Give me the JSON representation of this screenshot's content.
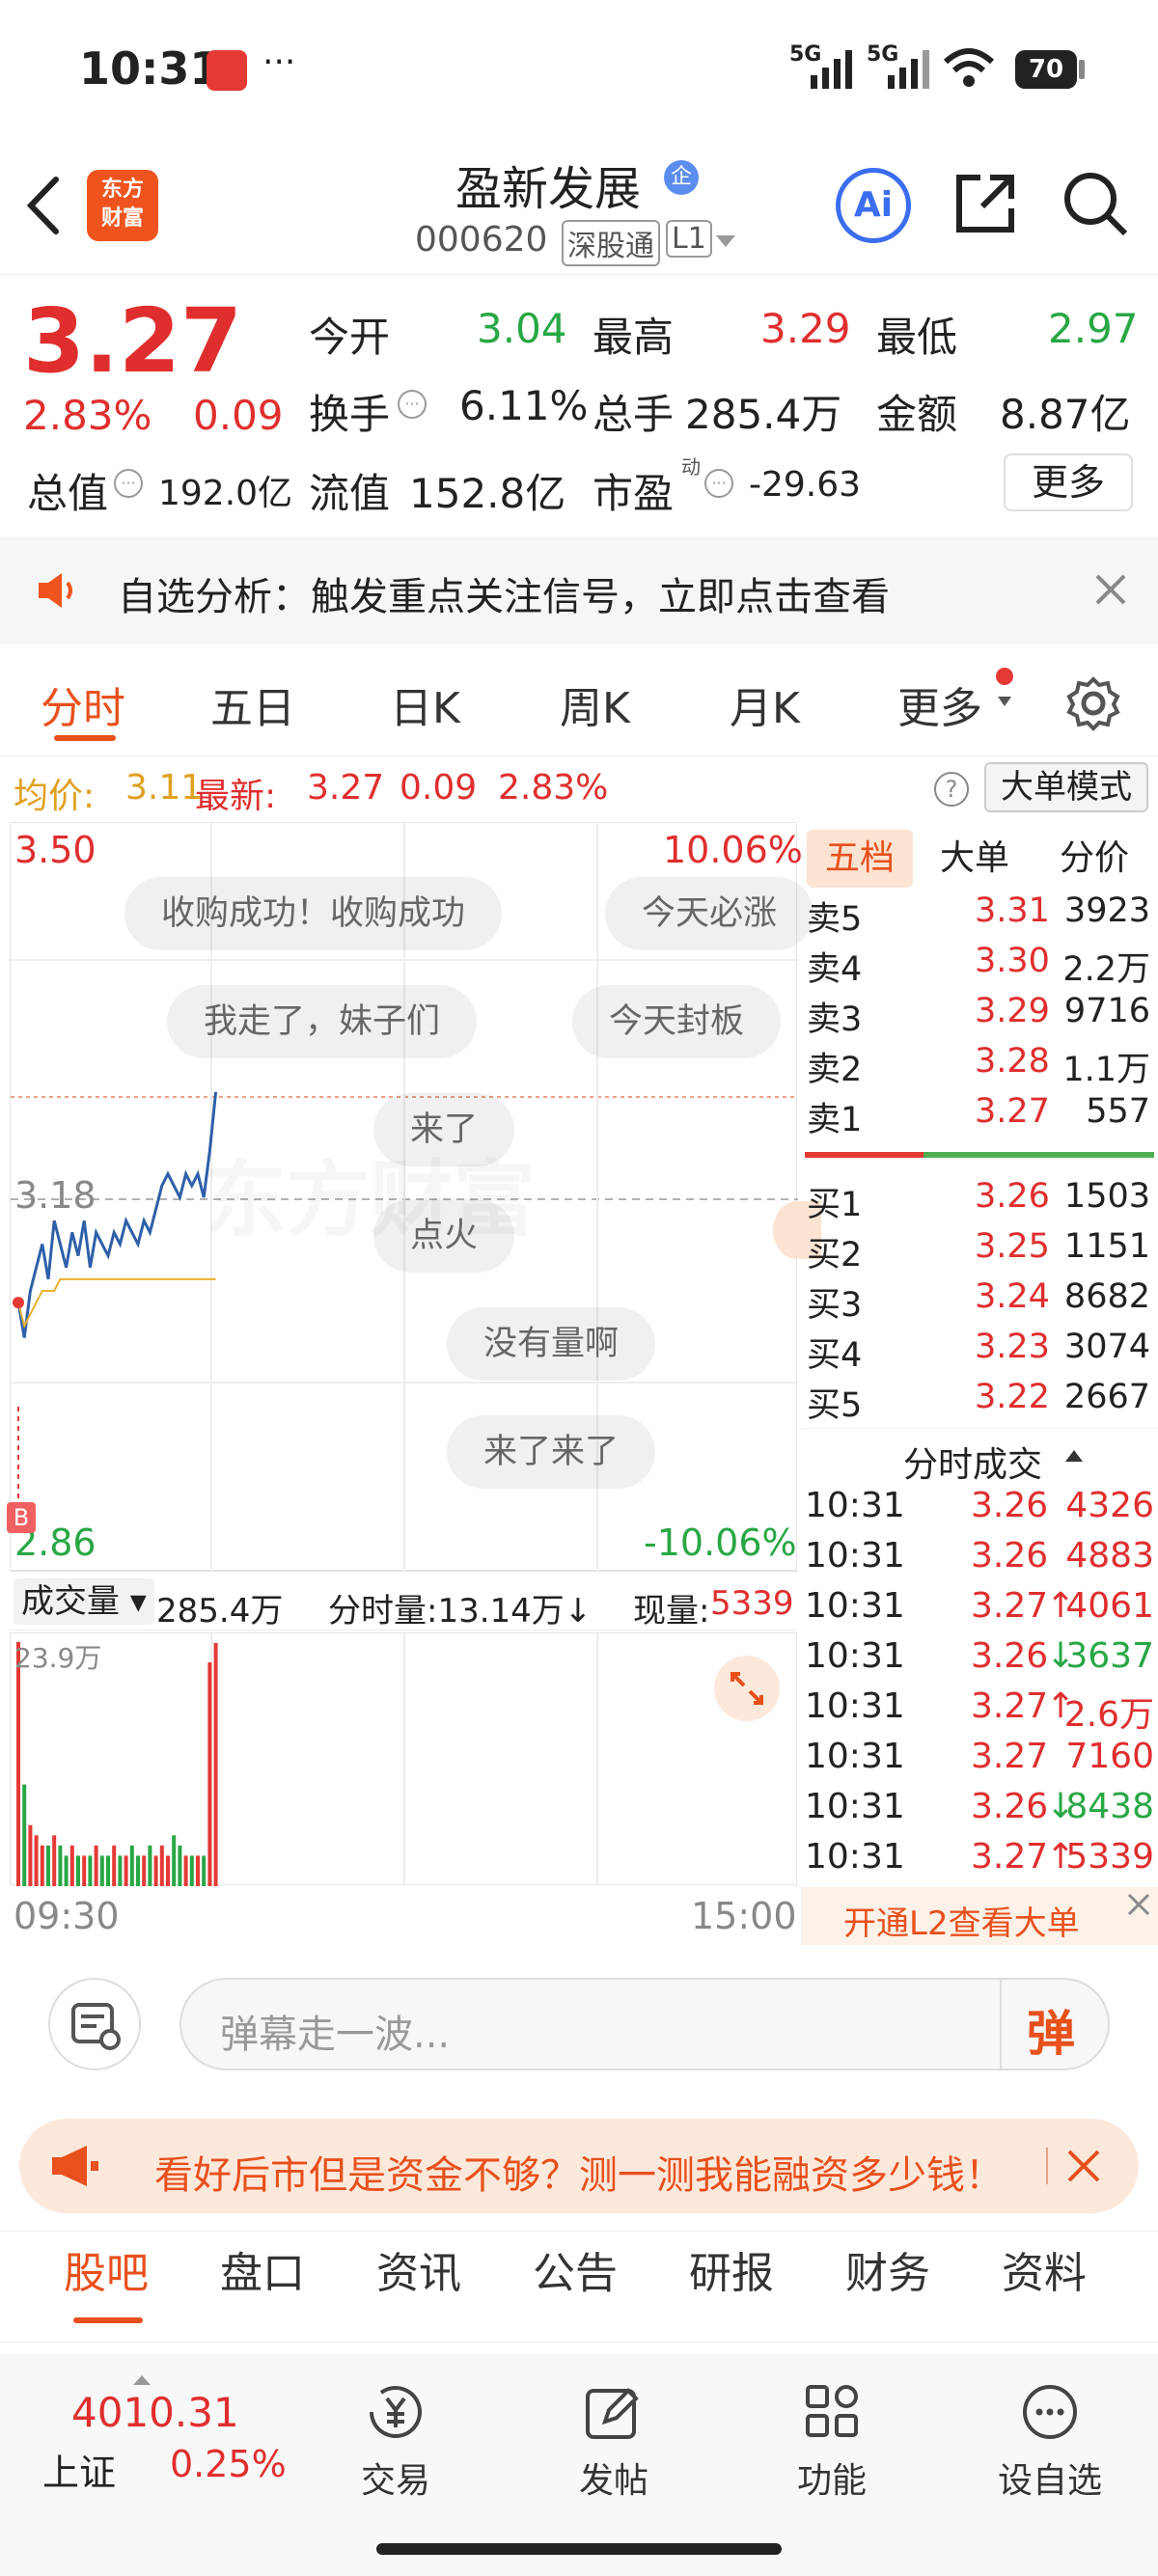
{
  "status_bar": {
    "time": "10:31",
    "dots": "···",
    "signal1": "5G",
    "signal2": "5G",
    "battery": "70"
  },
  "header": {
    "logo_line1": "东方",
    "logo_line2": "财富",
    "stock_name": "盈新发展",
    "badge": "企",
    "code": "000620",
    "exchange_tag": "深股通",
    "level_tag": "L1"
  },
  "quote": {
    "price": "3.27",
    "change_pct": "2.83%",
    "change": "0.09",
    "open_label": "今开",
    "open": "3.04",
    "high_label": "最高",
    "high": "3.29",
    "low_label": "最低",
    "low": "2.97",
    "turnover_label": "换手",
    "turnover": "6.11%",
    "volume_label": "总手",
    "volume": "285.4万",
    "amount_label": "金额",
    "amount": "8.87亿",
    "mktcap_label": "总值",
    "mktcap": "192.0亿",
    "float_label": "流值",
    "float": "152.8亿",
    "pe_label": "市盈",
    "pe_sup": "动",
    "pe": "-29.63",
    "more": "更多"
  },
  "notice": {
    "text": "自选分析：触发重点关注信号，立即点击查看"
  },
  "chart_tabs": [
    "分时",
    "五日",
    "日K",
    "周K",
    "月K",
    "更多"
  ],
  "info_line": {
    "avg_label": "均价:",
    "avg": "3.11",
    "latest_label": "最新:",
    "latest": "3.27",
    "chg": "0.09",
    "pct": "2.83%",
    "mode": "大单模式"
  },
  "chart_labels": {
    "top_price": "3.50",
    "top_pct": "10.06%",
    "mid_price": "3.18",
    "bot_price": "2.86",
    "bot_pct": "-10.06%",
    "b_marker": "B"
  },
  "danmaku": [
    "收购成功！收购成功",
    "今天必涨",
    "我走了，妹子们",
    "今天封板",
    "来了",
    "点火",
    "没有量啊",
    "来了来了"
  ],
  "volume_bar": {
    "label": "成交量",
    "total": "285.4万",
    "tick_label": "分时量:13.14万↓",
    "now_label": "现量:",
    "now": "5339",
    "max": "23.9万",
    "start_time": "09:30",
    "end_time": "15:00"
  },
  "chart_data": {
    "type": "line",
    "series": [
      {
        "values": [
          3.09,
          3.06,
          3.1,
          3.12,
          3.14,
          3.11,
          3.16,
          3.14,
          3.12,
          3.15,
          3.13,
          3.16,
          3.12,
          3.15,
          3.14,
          3.13,
          3.15,
          3.14,
          3.16,
          3.15,
          3.14,
          3.16,
          3.15,
          3.17,
          3.19,
          3.2,
          3.19,
          3.18,
          3.2,
          3.19,
          3.2,
          3.18,
          3.22,
          3.27
        ]
      },
      {
        "values": [
          3.09,
          3.07,
          3.08,
          3.09,
          3.1,
          3.1,
          3.1,
          3.11,
          3.11,
          3.11,
          3.11,
          3.11,
          3.11,
          3.11,
          3.11,
          3.11,
          3.11,
          3.11,
          3.11,
          3.11,
          3.11,
          3.11,
          3.11,
          3.11,
          3.11,
          3.11,
          3.11,
          3.11,
          3.11,
          3.11,
          3.11,
          3.11,
          3.11,
          3.11
        ]
      }
    ],
    "ylim": [
      2.86,
      3.5
    ],
    "volume_values": [
      24,
      10,
      6,
      5,
      4,
      4,
      5,
      4,
      3,
      4,
      3,
      3,
      3,
      4,
      3,
      3,
      4,
      3,
      3,
      4,
      3,
      3,
      4,
      3,
      4,
      3,
      5,
      4,
      3,
      3,
      3,
      3,
      22,
      23.9
    ],
    "volume_ylim": [
      0,
      23.9
    ]
  },
  "order_book": {
    "tabs": [
      "五档",
      "大单",
      "分价"
    ],
    "asks": [
      {
        "label": "卖5",
        "price": "3.31",
        "vol": "3923"
      },
      {
        "label": "卖4",
        "price": "3.30",
        "vol": "2.2万"
      },
      {
        "label": "卖3",
        "price": "3.29",
        "vol": "9716"
      },
      {
        "label": "卖2",
        "price": "3.28",
        "vol": "1.1万"
      },
      {
        "label": "卖1",
        "price": "3.27",
        "vol": "557"
      }
    ],
    "bids": [
      {
        "label": "买1",
        "price": "3.26",
        "vol": "1503"
      },
      {
        "label": "买2",
        "price": "3.25",
        "vol": "1151"
      },
      {
        "label": "买3",
        "price": "3.24",
        "vol": "8682"
      },
      {
        "label": "买4",
        "price": "3.23",
        "vol": "3074"
      },
      {
        "label": "买5",
        "price": "3.22",
        "vol": "2667"
      }
    ],
    "trades_title": "分时成交",
    "trades": [
      {
        "time": "10:31",
        "price": "3.26",
        "vol": "4326",
        "dir": ""
      },
      {
        "time": "10:31",
        "price": "3.26",
        "vol": "4883",
        "dir": ""
      },
      {
        "time": "10:31",
        "price": "3.27",
        "vol": "4061",
        "dir": "↑"
      },
      {
        "time": "10:31",
        "price": "3.26",
        "vol": "3637",
        "dir": "↓"
      },
      {
        "time": "10:31",
        "price": "3.27",
        "vol": "2.6万",
        "dir": "↑"
      },
      {
        "time": "10:31",
        "price": "3.27",
        "vol": "7160",
        "dir": ""
      },
      {
        "time": "10:31",
        "price": "3.26",
        "vol": "8438",
        "dir": "↓"
      },
      {
        "time": "10:31",
        "price": "3.27",
        "vol": "5339",
        "dir": "↑"
      }
    ],
    "l2_banner": "开通L2查看大单"
  },
  "danmaku_input": {
    "placeholder": "弹幕走一波...",
    "send": "弹"
  },
  "ad_banner": {
    "text": "看好后市但是资金不够？测一测我能融资多少钱！"
  },
  "bottom_tabs": [
    "股吧",
    "盘口",
    "资讯",
    "公告",
    "研报",
    "财务",
    "资料"
  ],
  "bottom_nav": {
    "index_value": "4010.31",
    "index_name": "上证",
    "index_pct": "0.25%",
    "trade": "交易",
    "post": "发帖",
    "func": "功能",
    "watch": "设自选"
  }
}
